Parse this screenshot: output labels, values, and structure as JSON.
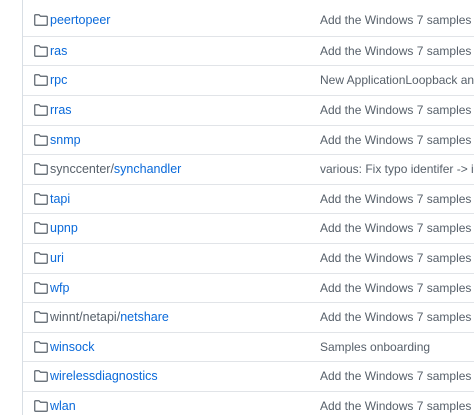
{
  "rows": [
    {
      "prefix": "",
      "link": "peertopeer",
      "message": "Add the Windows 7 samples"
    },
    {
      "prefix": "",
      "link": "ras",
      "message": "Add the Windows 7 samples"
    },
    {
      "prefix": "",
      "link": "rpc",
      "message": "New ApplicationLoopback and C"
    },
    {
      "prefix": "",
      "link": "rras",
      "message": "Add the Windows 7 samples"
    },
    {
      "prefix": "",
      "link": "snmp",
      "message": "Add the Windows 7 samples"
    },
    {
      "prefix": "synccenter/",
      "link": "synchandler",
      "message": "various: Fix typo identifer -> ide"
    },
    {
      "prefix": "",
      "link": "tapi",
      "message": "Add the Windows 7 samples"
    },
    {
      "prefix": "",
      "link": "upnp",
      "message": "Add the Windows 7 samples"
    },
    {
      "prefix": "",
      "link": "uri",
      "message": "Add the Windows 7 samples"
    },
    {
      "prefix": "",
      "link": "wfp",
      "message": "Add the Windows 7 samples"
    },
    {
      "prefix": "winnt/netapi/",
      "link": "netshare",
      "message": "Add the Windows 7 samples"
    },
    {
      "prefix": "",
      "link": "winsock",
      "message": "Samples onboarding"
    },
    {
      "prefix": "",
      "link": "wirelessdiagnostics",
      "message": "Add the Windows 7 samples"
    },
    {
      "prefix": "",
      "link": "wlan",
      "message": "Add the Windows 7 samples"
    }
  ],
  "colors": {
    "link": "#0969da",
    "muted": "#57606a",
    "border": "#e1e4e8"
  },
  "icon": "folder-icon"
}
